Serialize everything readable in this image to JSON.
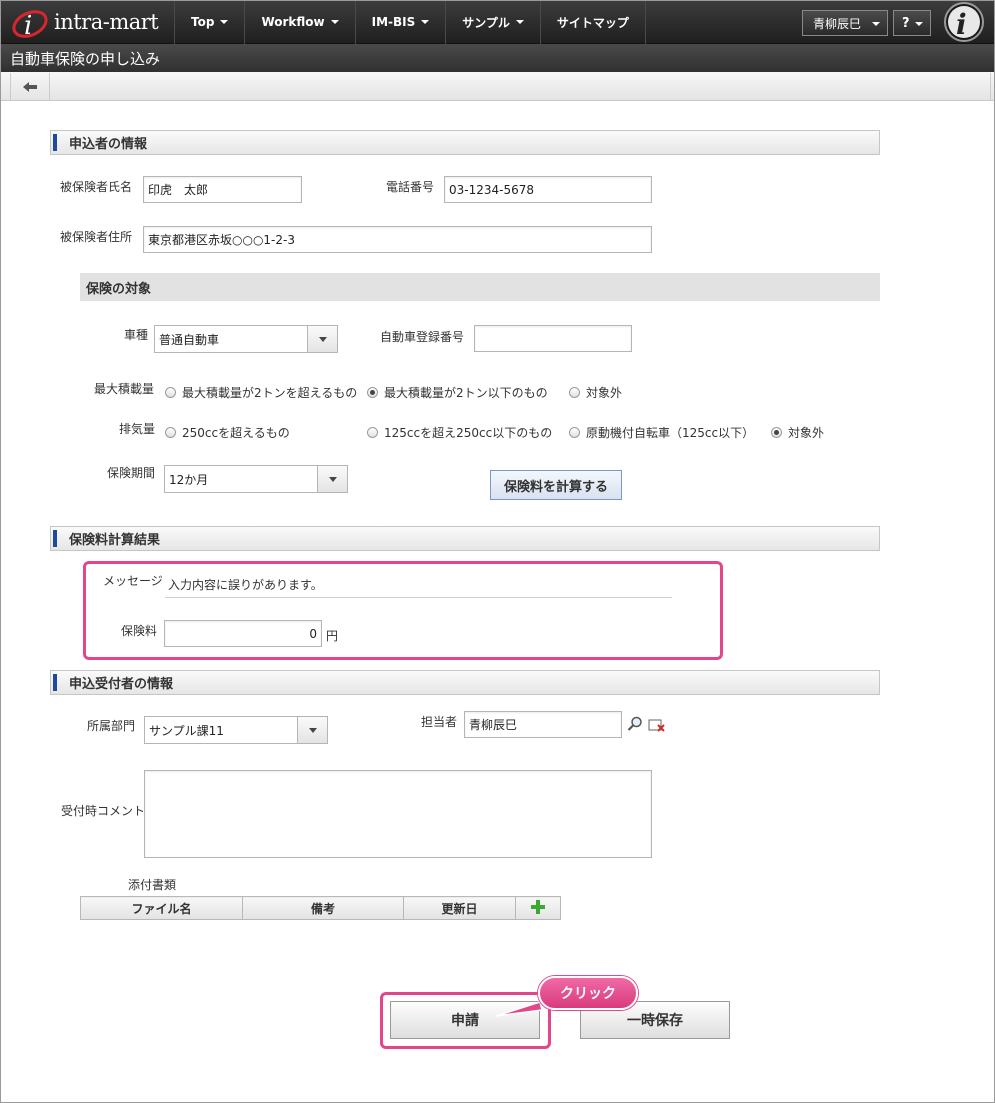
{
  "header": {
    "logo_text": "intra-mart",
    "nav": [
      {
        "label": "Top"
      },
      {
        "label": "Workflow"
      },
      {
        "label": "IM-BIS"
      },
      {
        "label": "サンプル"
      },
      {
        "label": "サイトマップ"
      }
    ],
    "user_label": "青柳辰巳",
    "help_label": "?"
  },
  "page_title": "自動車保険の申し込み",
  "applicant": {
    "section_title": "申込者の情報",
    "name_label": "被保険者氏名",
    "name_value": "印虎　太郎",
    "phone_label": "電話番号",
    "phone_value": "03-1234-5678",
    "address_label": "被保険者住所",
    "address_value": "東京都港区赤坂○○○1-2-3"
  },
  "insurance_target": {
    "section_title": "保険の対象",
    "car_type_label": "車種",
    "car_type_value": "普通自動車",
    "reg_number_label": "自動車登録番号",
    "reg_number_value": "",
    "max_load_label": "最大積載量",
    "max_load_options": [
      {
        "label": "最大積載量が2トンを超えるもの",
        "checked": false
      },
      {
        "label": "最大積載量が2トン以下のもの",
        "checked": true
      },
      {
        "label": "対象外",
        "checked": false
      }
    ],
    "displacement_label": "排気量",
    "displacement_options": [
      {
        "label": "250ccを超えるもの",
        "checked": false
      },
      {
        "label": "125ccを超え250cc以下のもの",
        "checked": false
      },
      {
        "label": "原動機付自転車（125cc以下）",
        "checked": false
      },
      {
        "label": "対象外",
        "checked": true
      }
    ],
    "period_label": "保険期間",
    "period_value": "12か月",
    "calc_button": "保険料を計算する"
  },
  "result": {
    "section_title": "保険料計算結果",
    "message_label": "メッセージ",
    "message_value": "入力内容に誤りがあります。",
    "fee_label": "保険料",
    "fee_value": "0",
    "fee_unit": "円"
  },
  "receiver": {
    "section_title": "申込受付者の情報",
    "dept_label": "所属部門",
    "dept_value": "サンプル課11",
    "person_label": "担当者",
    "person_value": "青柳辰巳",
    "comment_label": "受付時コメント",
    "comment_value": "",
    "attach_label": "添付書類",
    "attach_columns": [
      "ファイル名",
      "備考",
      "更新日"
    ]
  },
  "actions": {
    "apply_button": "申請",
    "save_button": "一時保存",
    "callout": "クリック"
  },
  "colors": {
    "highlight": "#e4468a",
    "section_accent": "#1c4aa0"
  }
}
